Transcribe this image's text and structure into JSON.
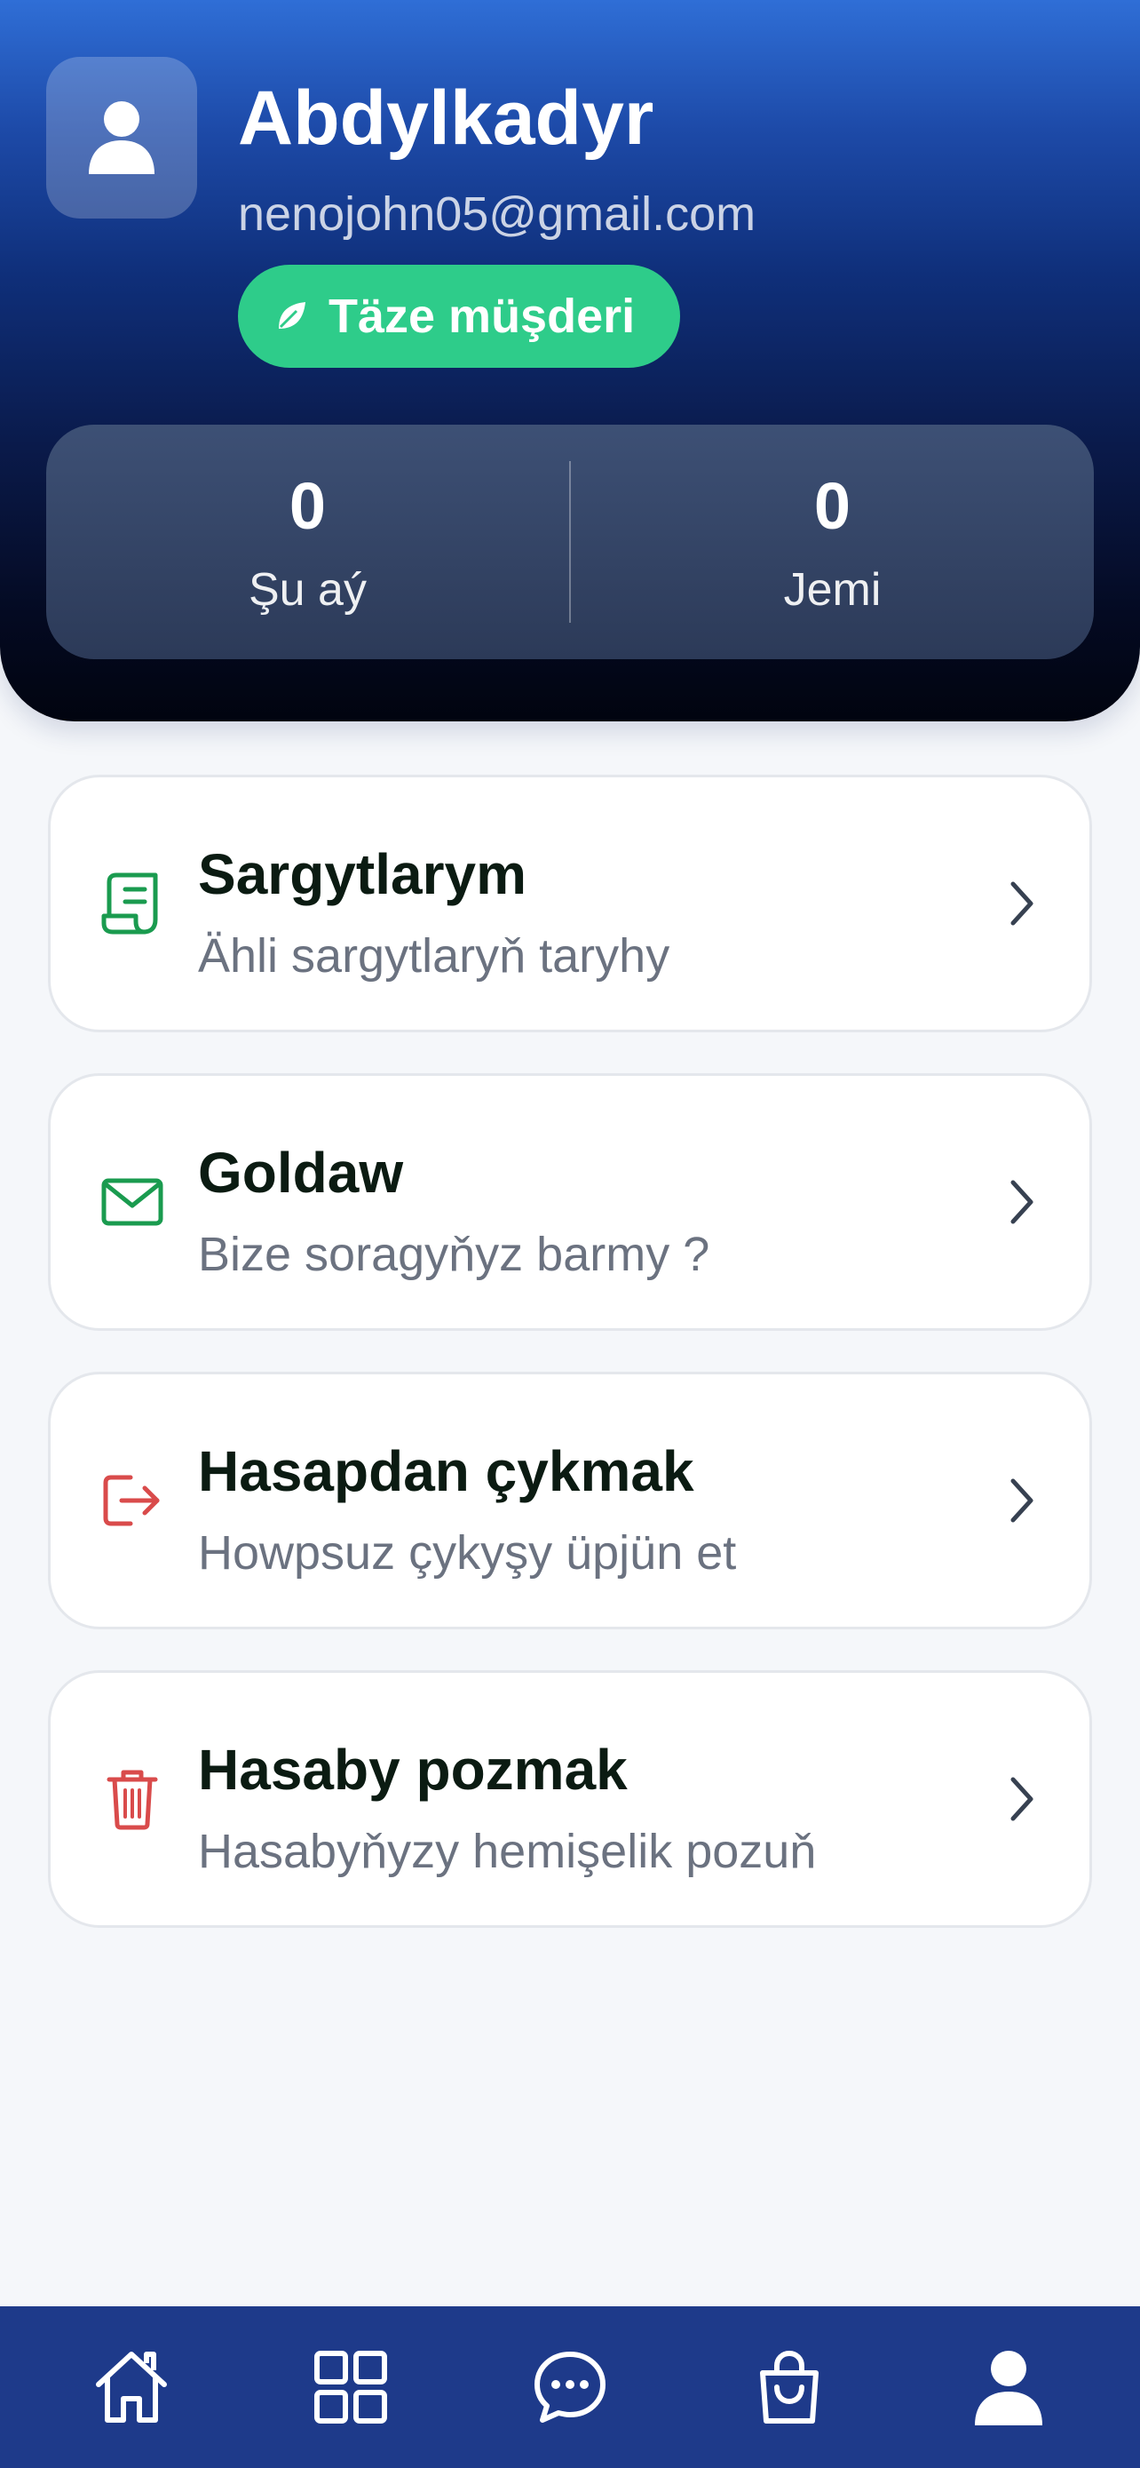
{
  "profile": {
    "name": "Abdylkadyr",
    "email": "nenojohn05@gmail.com",
    "badge_label": "Täze müşderi"
  },
  "stats": [
    {
      "value": "0",
      "label": "Şu aý"
    },
    {
      "value": "0",
      "label": "Jemi"
    }
  ],
  "menu": [
    {
      "title": "Sargytlarym",
      "subtitle": "Ähli sargytlaryň taryhy",
      "icon": "receipt-icon",
      "color": "#1a9b4f"
    },
    {
      "title": "Goldaw",
      "subtitle": "Bize soragyňyz barmy ?",
      "icon": "mail-icon",
      "color": "#1a9b4f"
    },
    {
      "title": "Hasapdan çykmak",
      "subtitle": "Howpsuz çykyşy üpjün et",
      "icon": "logout-icon",
      "color": "#d94b4b"
    },
    {
      "title": "Hasaby pozmak",
      "subtitle": "Hasabyňyzy hemişelik pozuň",
      "icon": "trash-icon",
      "color": "#d94b4b"
    }
  ],
  "nav": [
    {
      "icon": "home-icon"
    },
    {
      "icon": "grid-icon"
    },
    {
      "icon": "chat-icon"
    },
    {
      "icon": "shopping-bag-icon"
    },
    {
      "icon": "user-icon"
    }
  ],
  "colors": {
    "badge": "#2ecc8a",
    "nav_background": "#1e3a8a",
    "accent_green": "#1a9b4f",
    "accent_red": "#d94b4b"
  }
}
